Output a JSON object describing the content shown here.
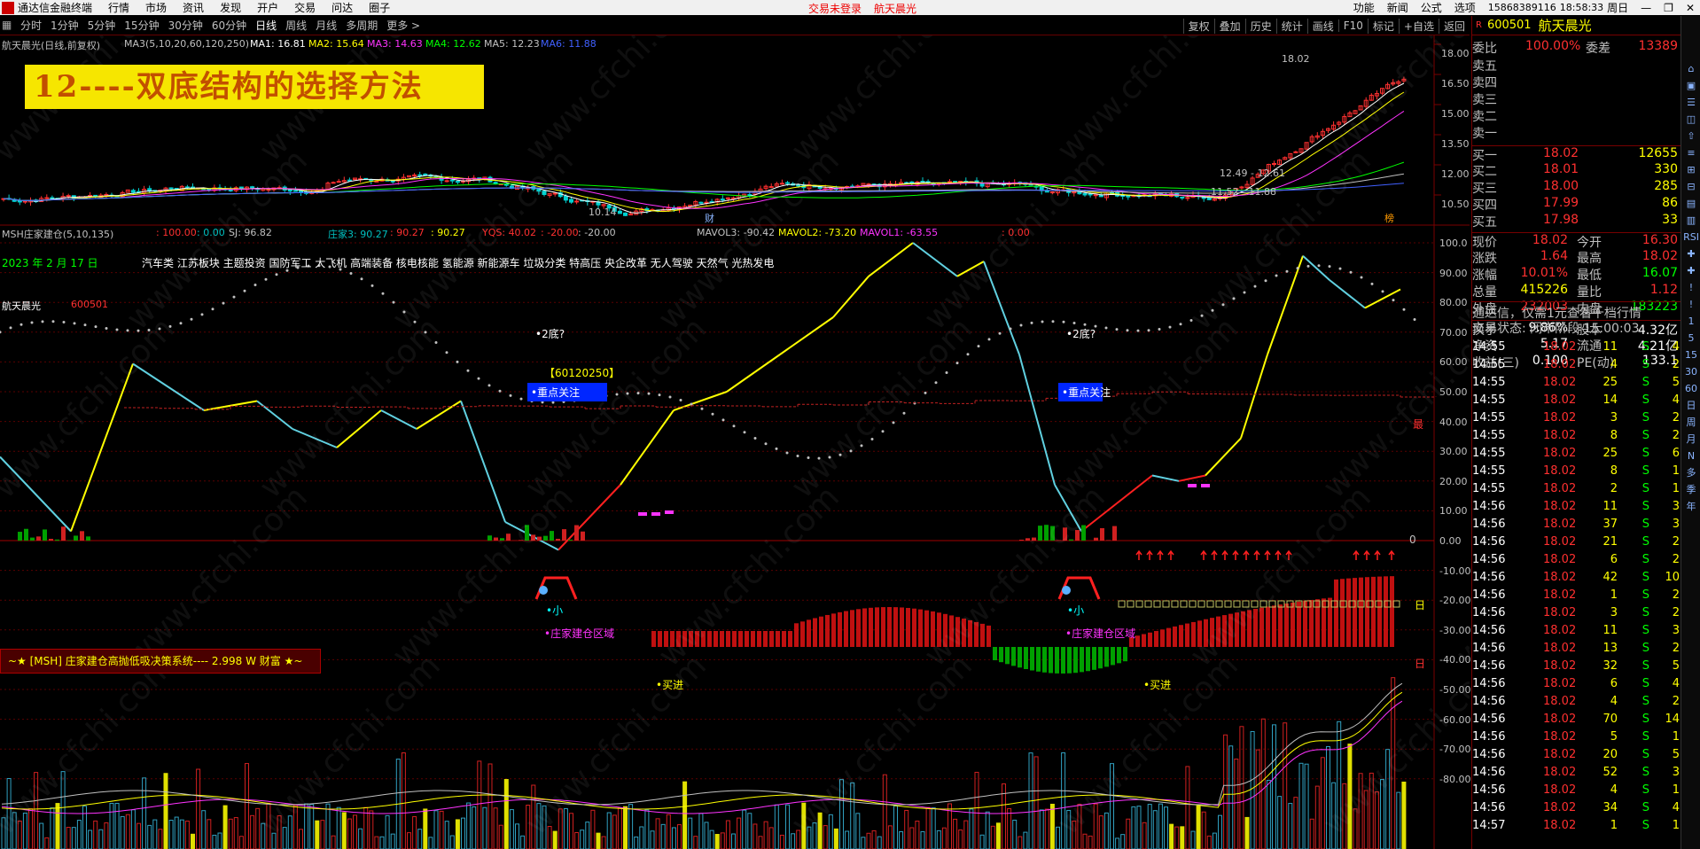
{
  "menubar": {
    "app_title": "通达信金融终端",
    "items": [
      "行情",
      "市场",
      "资讯",
      "发现",
      "开户",
      "交易",
      "问达",
      "圈子"
    ],
    "warn1": "交易未登录",
    "warn2": "航天晨光",
    "right": [
      "功能",
      "新闻",
      "公式",
      "选项"
    ],
    "account": "15868389116",
    "time": "18:58:33",
    "weekday": "周日"
  },
  "toolbar": {
    "periods": [
      "分时",
      "1分钟",
      "5分钟",
      "15分钟",
      "30分钟",
      "60分钟",
      "日线",
      "周线",
      "月线",
      "多周期",
      "更多 >"
    ],
    "selected": "日线",
    "tools": [
      "复权",
      "叠加",
      "历史",
      "统计",
      "画线",
      "F10",
      "标记",
      "+自选",
      "返回"
    ]
  },
  "chart_header": {
    "stock": "航天晨光(日线,前复权)",
    "ma_label": "MA3(5,10,20,60,120,250)",
    "ma1": "MA1: 16.81",
    "ma2": "MA2: 15.64",
    "ma3": "MA3: 14.63",
    "ma4": "MA4: 12.62",
    "ma5": "MA5: 12.23",
    "ma6": "MA6: 11.88"
  },
  "banner": "12----双底结构的选择方法",
  "price_labels": {
    "high": "18.02",
    "range1": "12.49 - 12.61",
    "range2": "11.52 - 11.88",
    "low": "10.14",
    "cai": "财",
    "cai2": "榜"
  },
  "price_axis": [
    "18.00",
    "16.50",
    "15.00",
    "13.50",
    "12.00",
    "10.50"
  ],
  "indicator_header": {
    "name": "MSH庄家建仓(5,10,135)",
    "v1": ": 100.00",
    "v2": ": 0.00",
    "sj": "SJ: 96.82",
    "zj3": "庄家3: 90.27",
    "v3": ": 90.27",
    "v4": ": 90.27",
    "yqs": "YQS: 40.02",
    "v5": ": -20.00",
    "v6": ": -20.00",
    "mavol3": "MAVOL3: -90.42",
    "mavol2": "MAVOL2: -73.20",
    "mavol1": "MAVOL1: -63.55",
    "v7": ": 0.00"
  },
  "date_label": "2023 年 2 月 17 日",
  "concepts": "汽车类 江苏板块 主题投资 国防军工 大飞机 高端装备 核电核能 氢能源 新能源车 垃圾分类 特高压 央企改革 无人驾驶 天然气 光热发电",
  "stock_tag": "航天晨光",
  "stock_code": "600501",
  "markers": {
    "double_bottom": "•2底?",
    "code_tag": "【60120250】",
    "focus": "•重点关注",
    "small": "•小",
    "build_zone": "•庄家建仓区域",
    "buy": "•买进",
    "zero": "0",
    "max_label": "最",
    "day_label": "日"
  },
  "legend_box": "~★ [MSH] 庄家建仓高抛低吸决策系统----  2.998 W   财富 ★~",
  "indicator_axis": [
    "100.0",
    "90.00",
    "80.00",
    "70.00",
    "60.00",
    "50.00",
    "40.00",
    "30.00",
    "20.00",
    "10.00",
    "0.00",
    "-10.00",
    "-20.00",
    "-30.00",
    "-40.00",
    "-50.00",
    "-60.00",
    "-70.00",
    "-80.00"
  ],
  "quote": {
    "code": "600501",
    "name": "航天晨光",
    "weibi_label": "委比",
    "weibi": "100.00%",
    "weicha_label": "委差",
    "weicha": "13389",
    "sell": [
      {
        "l": "卖五"
      },
      {
        "l": "卖四"
      },
      {
        "l": "卖三"
      },
      {
        "l": "卖二"
      },
      {
        "l": "卖一"
      }
    ],
    "buy": [
      {
        "l": "买一",
        "p": "18.02",
        "v": "12655"
      },
      {
        "l": "买二",
        "p": "18.01",
        "v": "330"
      },
      {
        "l": "买三",
        "p": "18.00",
        "v": "285"
      },
      {
        "l": "买四",
        "p": "17.99",
        "v": "86"
      },
      {
        "l": "买五",
        "p": "17.98",
        "v": "33"
      }
    ],
    "stats": [
      {
        "l1": "现价",
        "v1": "18.02",
        "l2": "今开",
        "v2": "16.30"
      },
      {
        "l1": "涨跌",
        "v1": "1.64",
        "l2": "最高",
        "v2": "18.02"
      },
      {
        "l1": "涨幅",
        "v1": "10.01%",
        "l2": "最低",
        "v2": "16.07"
      },
      {
        "l1": "总量",
        "v1": "415226",
        "l2": "量比",
        "v2": "1.12"
      },
      {
        "l1": "外盘",
        "v1": "232003",
        "l2": "内盘",
        "v2": "183223"
      },
      {
        "l1": "换手",
        "v1": "9.86%",
        "l2": "股本",
        "v2": "4.32亿"
      },
      {
        "l1": "净资",
        "v1": "5.17",
        "l2": "流通",
        "v2": "4.21亿"
      },
      {
        "l1": "收益(三)",
        "v1": "0.100",
        "l2": "PE(动)",
        "v2": "133.1"
      }
    ],
    "notice": "通达信，仅需1元查看千档行情",
    "trade_status": "交易状态: 闭市阶段 15:00:03"
  },
  "ticks": [
    [
      "14:55",
      "18.02",
      "11",
      "S",
      "4"
    ],
    [
      "14:55",
      "18.02",
      "4",
      "S",
      "2"
    ],
    [
      "14:55",
      "18.02",
      "25",
      "S",
      "5"
    ],
    [
      "14:55",
      "18.02",
      "14",
      "S",
      "4"
    ],
    [
      "14:55",
      "18.02",
      "3",
      "S",
      "2"
    ],
    [
      "14:55",
      "18.02",
      "8",
      "S",
      "2"
    ],
    [
      "14:55",
      "18.02",
      "25",
      "S",
      "6"
    ],
    [
      "14:55",
      "18.02",
      "8",
      "S",
      "1"
    ],
    [
      "14:55",
      "18.02",
      "2",
      "S",
      "1"
    ],
    [
      "14:56",
      "18.02",
      "11",
      "S",
      "3"
    ],
    [
      "14:56",
      "18.02",
      "37",
      "S",
      "3"
    ],
    [
      "14:56",
      "18.02",
      "21",
      "S",
      "2"
    ],
    [
      "14:56",
      "18.02",
      "6",
      "S",
      "2"
    ],
    [
      "14:56",
      "18.02",
      "42",
      "S",
      "10"
    ],
    [
      "14:56",
      "18.02",
      "1",
      "S",
      "2"
    ],
    [
      "14:56",
      "18.02",
      "3",
      "S",
      "2"
    ],
    [
      "14:56",
      "18.02",
      "11",
      "S",
      "3"
    ],
    [
      "14:56",
      "18.02",
      "13",
      "S",
      "2"
    ],
    [
      "14:56",
      "18.02",
      "32",
      "S",
      "5"
    ],
    [
      "14:56",
      "18.02",
      "6",
      "S",
      "4"
    ],
    [
      "14:56",
      "18.02",
      "4",
      "S",
      "2"
    ],
    [
      "14:56",
      "18.02",
      "70",
      "S",
      "14"
    ],
    [
      "14:56",
      "18.02",
      "5",
      "S",
      "1"
    ],
    [
      "14:56",
      "18.02",
      "20",
      "S",
      "5"
    ],
    [
      "14:56",
      "18.02",
      "52",
      "S",
      "3"
    ],
    [
      "14:56",
      "18.02",
      "4",
      "S",
      "1"
    ],
    [
      "14:56",
      "18.02",
      "34",
      "S",
      "4"
    ],
    [
      "14:57",
      "18.02",
      "1",
      "S",
      "1"
    ]
  ],
  "sidebar": [
    "⌂",
    "▣",
    "☰",
    "◫",
    "⇧",
    "≡",
    "⊞",
    "⊟",
    "▤",
    "▥",
    "RSI",
    "✚",
    "✚",
    "!",
    "!",
    "1",
    "5",
    "15",
    "30",
    "60",
    "日",
    "周",
    "月",
    "N",
    "多",
    "季",
    "年"
  ],
  "colors": {
    "up": "#ff3030",
    "down": "#00c0c0",
    "yellow": "#ffff00",
    "bg": "#000000",
    "grid": "#7a0000"
  }
}
